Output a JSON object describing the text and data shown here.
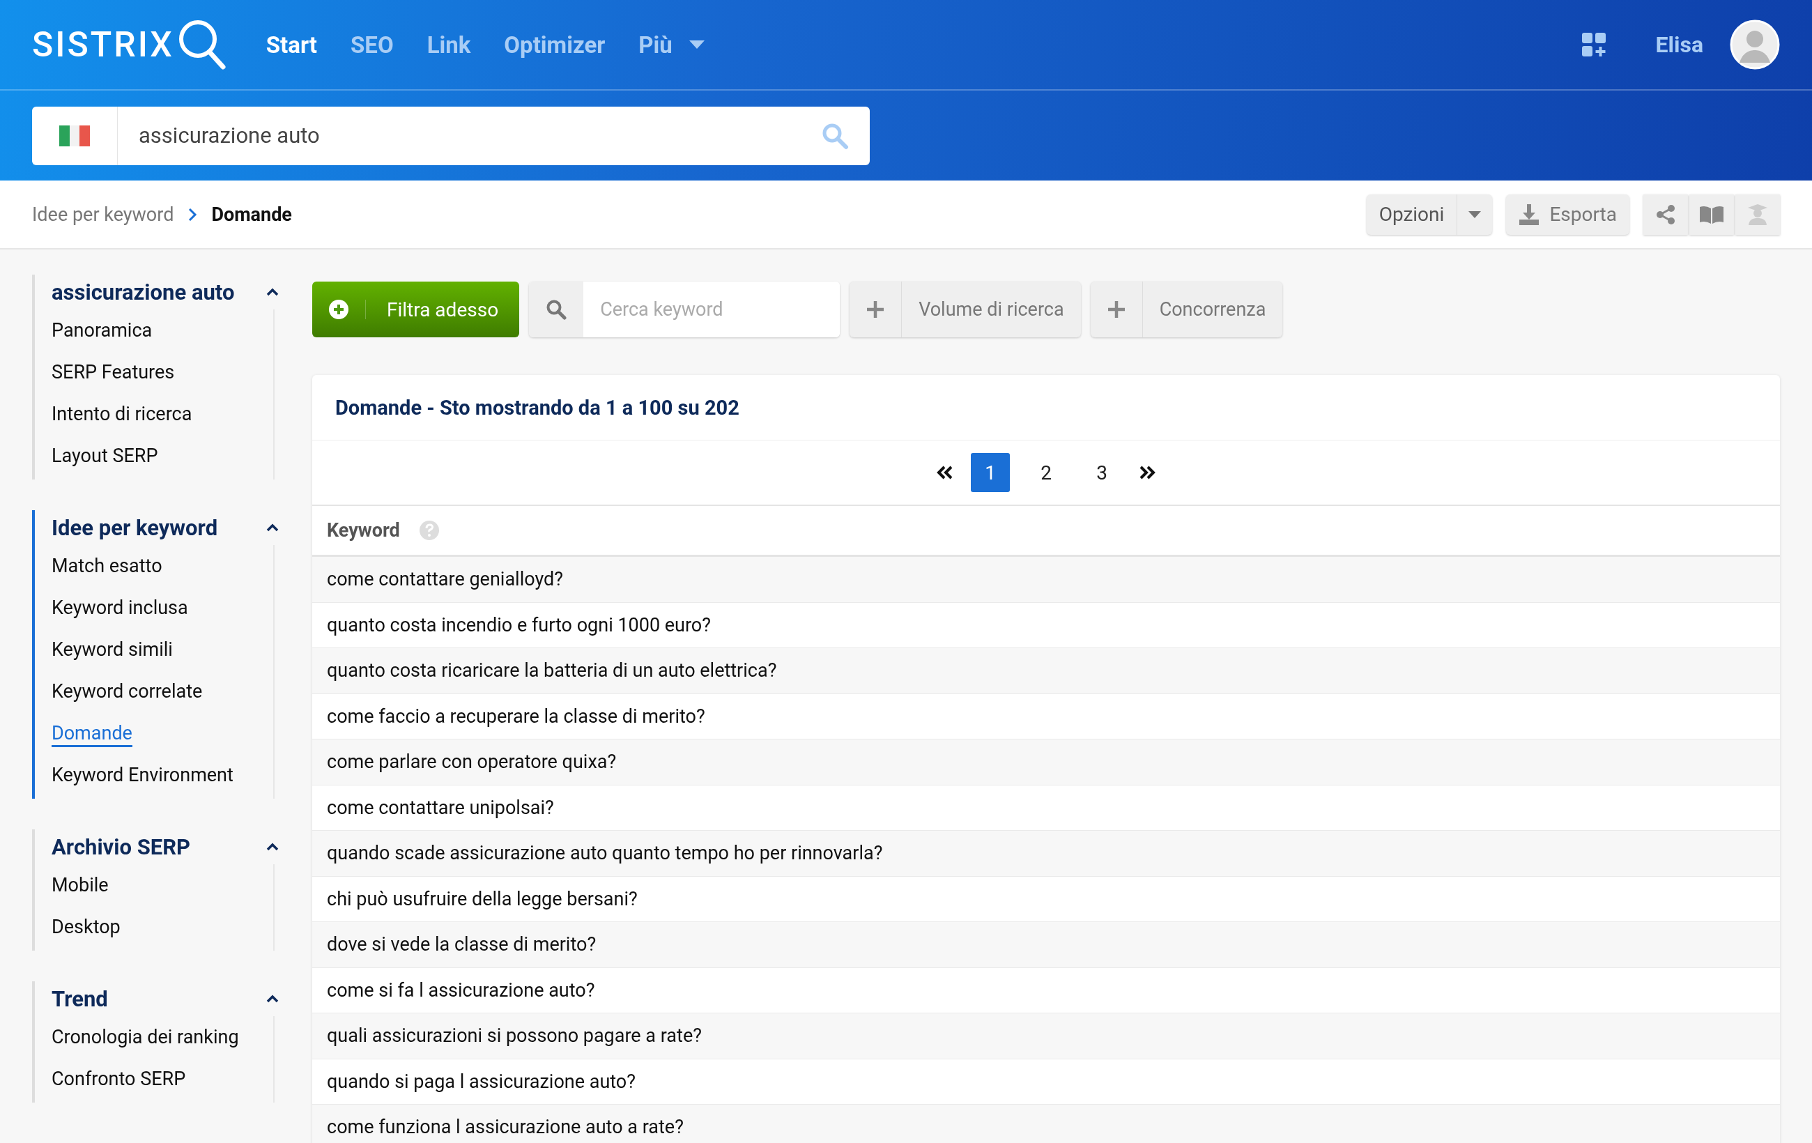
{
  "header": {
    "logo": "SISTRIX",
    "nav": [
      {
        "label": "Start",
        "selected": true
      },
      {
        "label": "SEO",
        "selected": false
      },
      {
        "label": "Link",
        "selected": false
      },
      {
        "label": "Optimizer",
        "selected": false
      },
      {
        "label": "Più",
        "selected": false
      }
    ],
    "user": "Elisa"
  },
  "search": {
    "value": "assicurazione auto"
  },
  "breadcrumb": [
    "Idee per keyword",
    "Domande"
  ],
  "actions": {
    "options": "Opzioni",
    "export": "Esporta"
  },
  "sidebar": [
    {
      "title": "assicurazione auto",
      "expanded": true,
      "active": false,
      "items": [
        {
          "label": "Panoramica",
          "selected": false
        },
        {
          "label": "SERP Features",
          "selected": false
        },
        {
          "label": "Intento di ricerca",
          "selected": false
        },
        {
          "label": "Layout SERP",
          "selected": false
        }
      ]
    },
    {
      "title": "Idee per keyword",
      "expanded": true,
      "active": true,
      "items": [
        {
          "label": "Match esatto",
          "selected": false
        },
        {
          "label": "Keyword inclusa",
          "selected": false
        },
        {
          "label": "Keyword simili",
          "selected": false
        },
        {
          "label": "Keyword correlate",
          "selected": false
        },
        {
          "label": "Domande",
          "selected": true
        },
        {
          "label": "Keyword Environment",
          "selected": false
        }
      ]
    },
    {
      "title": "Archivio SERP",
      "expanded": true,
      "active": false,
      "items": [
        {
          "label": "Mobile",
          "selected": false
        },
        {
          "label": "Desktop",
          "selected": false
        }
      ]
    },
    {
      "title": "Trend",
      "expanded": true,
      "active": false,
      "items": [
        {
          "label": "Cronologia dei ranking",
          "selected": false
        },
        {
          "label": "Confronto SERP",
          "selected": false
        }
      ]
    }
  ],
  "filters": {
    "filter_button": "Filtra adesso",
    "search_placeholder": "Cerca keyword",
    "add": [
      "Volume di ricerca",
      "Concorrenza"
    ]
  },
  "card": {
    "title": "Domande - Sto mostrando da 1 a 100 su 202",
    "pages": [
      {
        "label": "1",
        "selected": true
      },
      {
        "label": "2",
        "selected": false
      },
      {
        "label": "3",
        "selected": false
      }
    ],
    "column": "Keyword",
    "rows": [
      "come contattare genialloyd?",
      "quanto costa incendio e furto ogni 1000 euro?",
      "quanto costa ricaricare la batteria di un auto elettrica?",
      "come faccio a recuperare la classe di merito?",
      "come parlare con operatore quixa?",
      "come contattare unipolsai?",
      "quando scade assicurazione auto quanto tempo ho per rinnovarla?",
      "chi può usufruire della legge bersani?",
      "dove si vede la classe di merito?",
      "come si fa l assicurazione auto?",
      "quali assicurazioni si possono pagare a rate?",
      "quando si paga l assicurazione auto?",
      "come funziona l assicurazione auto a rate?"
    ]
  }
}
